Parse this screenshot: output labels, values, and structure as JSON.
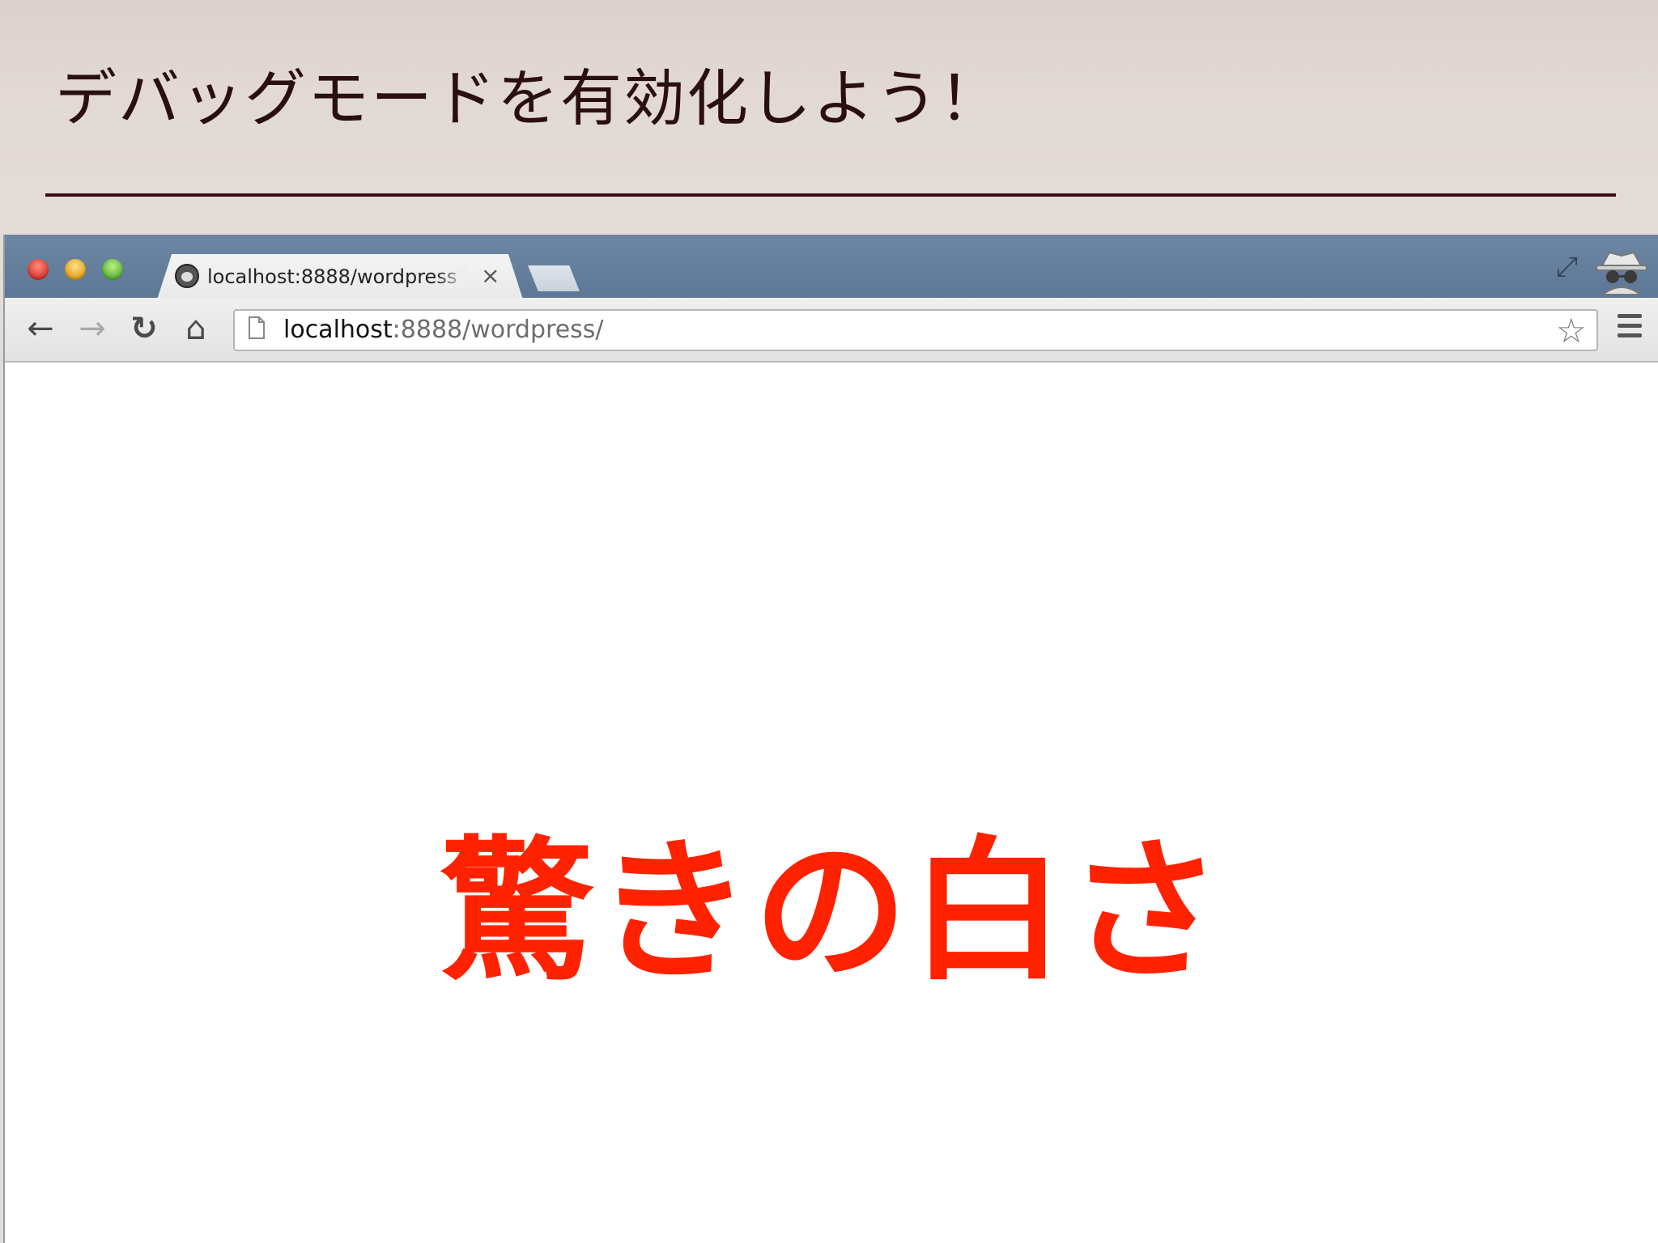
{
  "slide": {
    "title": "デバッグモードを有効化しよう！",
    "rule_color": "#3a0c12"
  },
  "browser": {
    "tab": {
      "title": "localhost:8888/wordpress",
      "close_glyph": "×",
      "favicon": "wordpress-icon"
    },
    "toolbar": {
      "back_glyph": "←",
      "forward_glyph": "→",
      "reload_glyph": "↻",
      "home_glyph": "⌂",
      "star_glyph": "☆",
      "fullscreen_glyph": "⤢"
    },
    "address_bar": {
      "host": "localhost",
      "rest": ":8888/wordpress/"
    }
  },
  "page": {
    "headline": "驚きの白さ",
    "headline_color": "#ff2200"
  },
  "colors": {
    "tabstrip": "#6580a0",
    "slide_background": "#e3dbd7"
  }
}
